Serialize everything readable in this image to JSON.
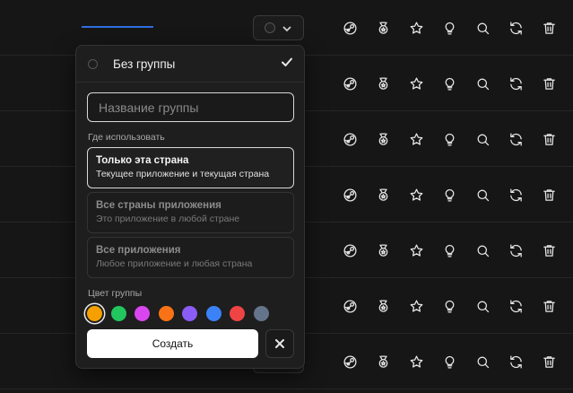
{
  "popover": {
    "no_group_label": "Без группы",
    "name_placeholder": "Название группы",
    "scope_label": "Где использовать",
    "scope_options": [
      {
        "title": "Только эта страна",
        "subtitle": "Текущее приложение и текущая страна",
        "selected": true
      },
      {
        "title": "Все страны приложения",
        "subtitle": "Это приложение в любой стране",
        "selected": false
      },
      {
        "title": "Все приложения",
        "subtitle": "Любое приложение и любая страна",
        "selected": false
      }
    ],
    "color_label": "Цвет группы",
    "colors": [
      "#f5a000",
      "#22c55e",
      "#d946ef",
      "#f97316",
      "#8b5cf6",
      "#3b82f6",
      "#ef4444",
      "#64748b"
    ],
    "selected_color": "#f5a000",
    "create_label": "Создать"
  },
  "row_actions": [
    {
      "icon": "steam-icon"
    },
    {
      "icon": "medal-icon"
    },
    {
      "icon": "star-icon"
    },
    {
      "icon": "lightbulb-icon"
    },
    {
      "icon": "search-icon"
    },
    {
      "icon": "refresh-icon"
    },
    {
      "icon": "trash-icon"
    }
  ],
  "accent_color": "#2f6fe0"
}
